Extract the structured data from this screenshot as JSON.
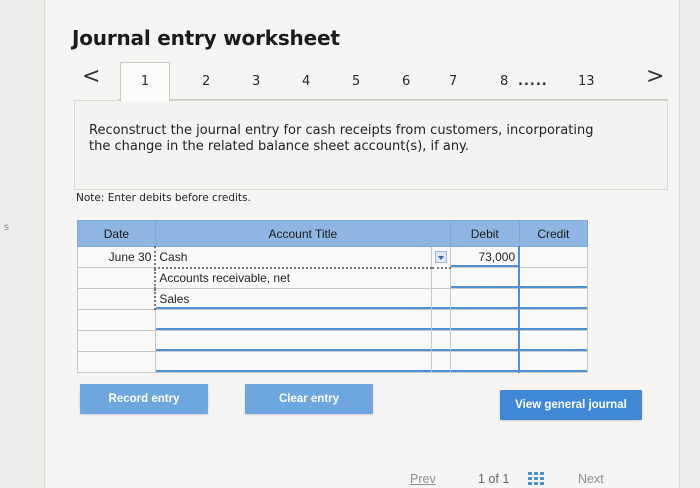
{
  "side_mark": "s",
  "title": "Journal entry worksheet",
  "tabs": {
    "prev_glyph": "<",
    "next_glyph": ">",
    "items": [
      "1",
      "2",
      "3",
      "4",
      "5",
      "6",
      "7",
      "8",
      ".....",
      "13"
    ],
    "active": "1"
  },
  "prompt": "Reconstruct the journal entry for cash receipts from customers, incorporating the change in the related balance sheet account(s), if any.",
  "note": "Note: Enter debits before credits.",
  "table": {
    "headers": {
      "date": "Date",
      "account": "Account Title",
      "debit": "Debit",
      "credit": "Credit"
    },
    "rows": [
      {
        "date": "June 30",
        "account": "Cash",
        "debit": "73,000",
        "credit": ""
      },
      {
        "date": "",
        "account": "Accounts receivable, net",
        "debit": "",
        "credit": ""
      },
      {
        "date": "",
        "account": "Sales",
        "debit": "",
        "credit": ""
      },
      {
        "date": "",
        "account": "",
        "debit": "",
        "credit": ""
      },
      {
        "date": "",
        "account": "",
        "debit": "",
        "credit": ""
      },
      {
        "date": "",
        "account": "",
        "debit": "",
        "credit": ""
      }
    ]
  },
  "buttons": {
    "record": "Record entry",
    "clear": "Clear entry",
    "view_journal": "View general journal"
  },
  "footer": {
    "prev": "Prev",
    "page": "1 of 1",
    "next": "Next"
  },
  "colors": {
    "header_blue": "#8fb6e3",
    "button_light": "#6ea6e0",
    "button_dark": "#3f88d6"
  }
}
